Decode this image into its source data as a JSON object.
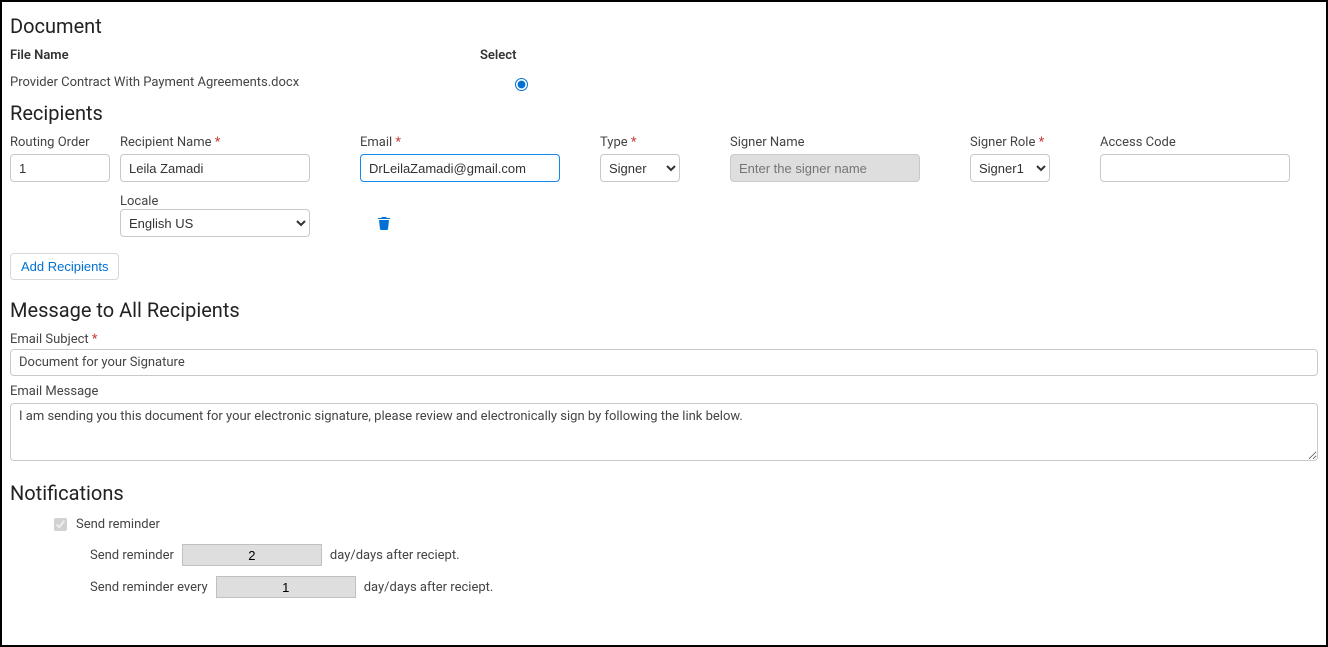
{
  "document": {
    "heading": "Document",
    "file_name_header": "File Name",
    "select_header": "Select",
    "file_name": "Provider Contract With Payment Agreements.docx",
    "selected": true
  },
  "recipients": {
    "heading": "Recipients",
    "labels": {
      "routing_order": "Routing Order",
      "recipient_name": "Recipient Name",
      "email": "Email",
      "type": "Type",
      "signer_name": "Signer Name",
      "signer_role": "Signer Role",
      "access_code": "Access Code",
      "locale": "Locale"
    },
    "row": {
      "routing_order": "1",
      "recipient_name": "Leila Zamadi",
      "email": "DrLeilaZamadi@gmail.com",
      "type_selected": "Signer",
      "signer_name_placeholder": "Enter the signer name",
      "signer_name": "",
      "signer_role_selected": "Signer1",
      "access_code": "",
      "locale_selected": "English US"
    },
    "add_button": "Add Recipients"
  },
  "message": {
    "heading": "Message to All Recipients",
    "subject_label": "Email Subject",
    "subject_value": "Document for your Signature",
    "body_label": "Email Message",
    "body_value": "I am sending you this document for your electronic signature, please review and electronically sign by following the link below."
  },
  "notifications": {
    "heading": "Notifications",
    "send_reminder_label": "Send reminder",
    "send_reminder_checked": true,
    "line1_prefix": "Send reminder",
    "line1_value": "2",
    "line1_suffix": "day/days after reciept.",
    "line2_prefix": "Send reminder every",
    "line2_value": "1",
    "line2_suffix": "day/days after reciept."
  }
}
